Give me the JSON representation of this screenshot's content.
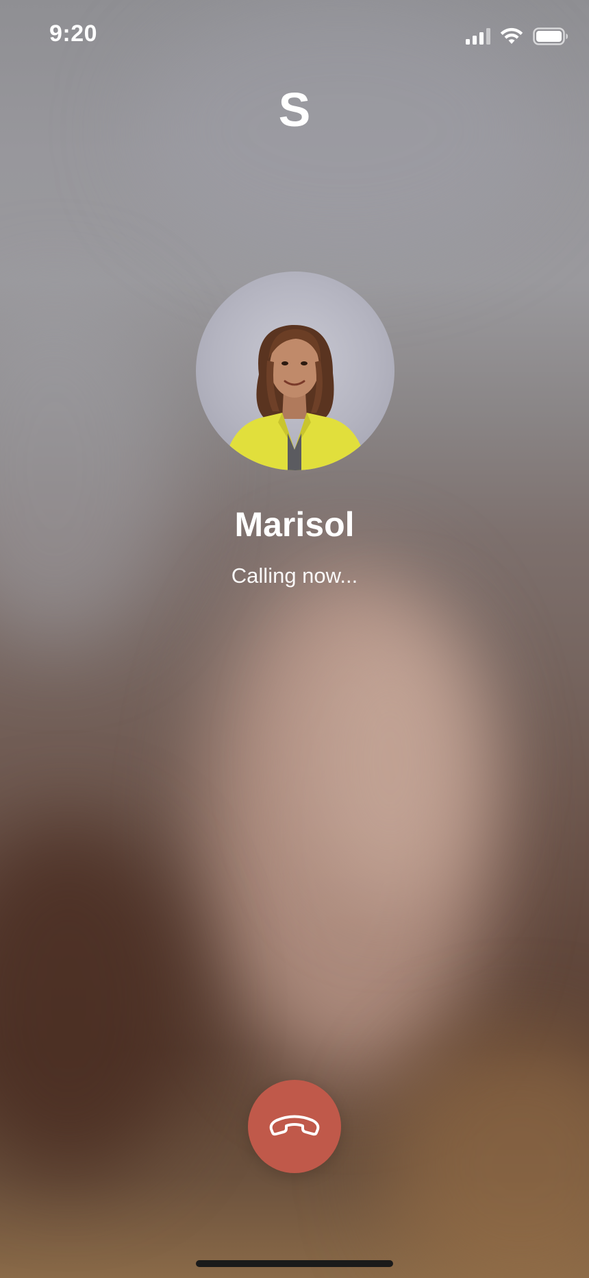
{
  "status_bar": {
    "time": "9:20",
    "icons": [
      "cellular-signal-icon",
      "wifi-icon",
      "battery-icon"
    ]
  },
  "app": {
    "initial": "S"
  },
  "contact": {
    "name": "Marisol",
    "status": "Calling now...",
    "avatar": "contact-photo"
  },
  "actions": {
    "end_call_icon": "phone-hangup-icon",
    "end_call_color": "#c0594a"
  }
}
